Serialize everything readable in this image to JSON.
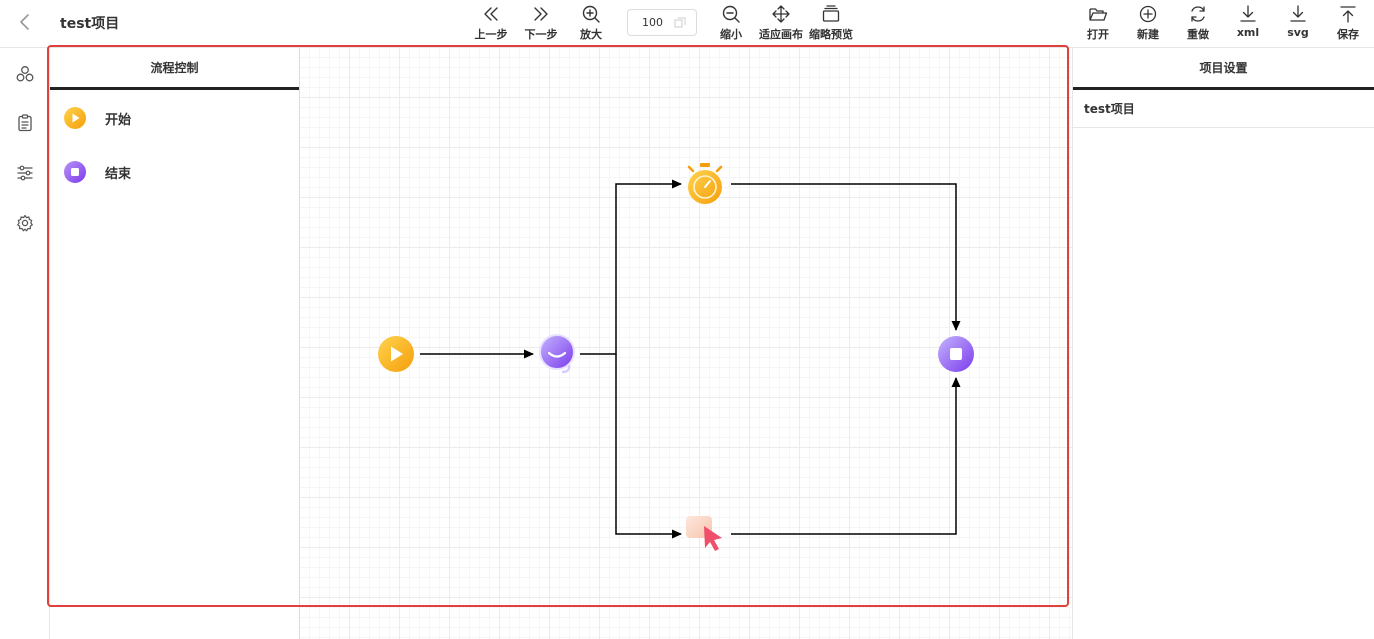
{
  "header": {
    "title": "test项目",
    "back_icon": "chevron-left-icon"
  },
  "toolbar": {
    "undo": {
      "label": "上一步",
      "icon": "double-chevron-left-icon"
    },
    "redo": {
      "label": "下一步",
      "icon": "double-chevron-right-icon"
    },
    "zoom_in": {
      "label": "放大",
      "icon": "zoom-in-icon"
    },
    "zoom_value": "100",
    "zoom_out": {
      "label": "缩小",
      "icon": "zoom-out-icon"
    },
    "fit_canvas": {
      "label": "适应画布",
      "icon": "move-arrows-icon"
    },
    "preview": {
      "label": "缩略预览",
      "icon": "stack-icon"
    },
    "open": {
      "label": "打开",
      "icon": "folder-open-icon"
    },
    "new": {
      "label": "新建",
      "icon": "plus-circle-icon"
    },
    "redo_all": {
      "label": "重做",
      "icon": "refresh-icon"
    },
    "export_xml": {
      "label": "xml",
      "icon": "download-icon"
    },
    "export_svg": {
      "label": "svg",
      "icon": "download-icon"
    },
    "save": {
      "label": "保存",
      "icon": "upload-icon"
    }
  },
  "rail": {
    "icons": [
      "nodes-icon",
      "clipboard-icon",
      "sliders-icon",
      "gear-icon"
    ]
  },
  "palette": {
    "title": "流程控制",
    "items": [
      {
        "label": "开始",
        "icon": "play-circle-icon"
      },
      {
        "label": "结束",
        "icon": "stop-circle-icon"
      }
    ]
  },
  "canvas": {
    "nodes": [
      {
        "type": "start",
        "icon": "play-circle-icon"
      },
      {
        "type": "task",
        "icon": "chat-bubble-icon"
      },
      {
        "type": "timer",
        "icon": "stopwatch-icon"
      },
      {
        "type": "user-task",
        "icon": "cursor-click-icon"
      },
      {
        "type": "end",
        "icon": "stop-circle-icon"
      }
    ]
  },
  "properties": {
    "title": "项目设置",
    "project_name": "test项目"
  },
  "colors": {
    "accent_orange": "#f7a51e",
    "accent_purple": "#8b5cf6",
    "highlight_red": "#e0413d"
  }
}
